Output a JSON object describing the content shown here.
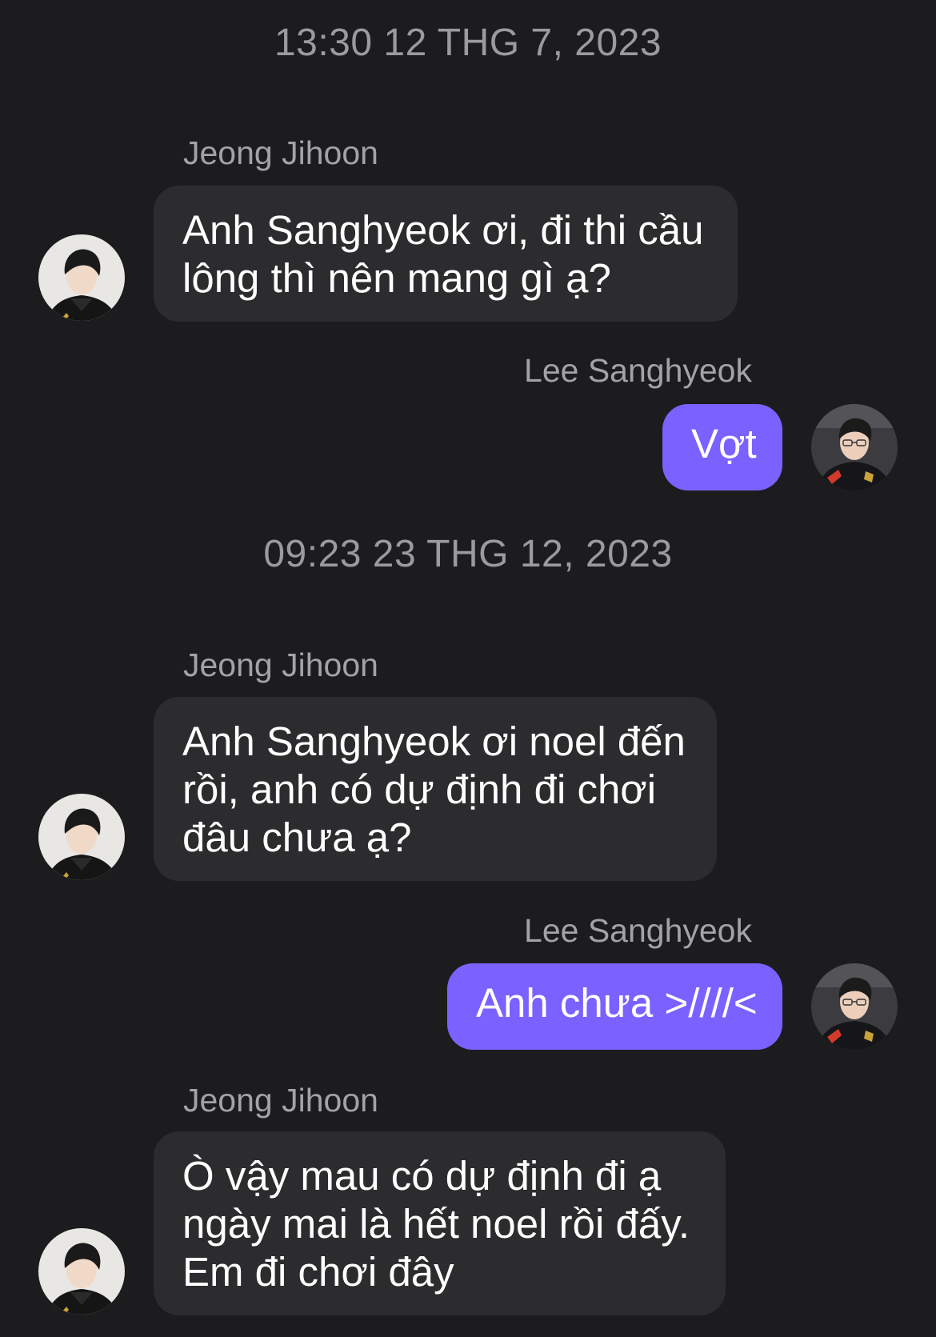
{
  "conversation": {
    "timestamps": [
      "13:30 12 THG 7, 2023",
      "09:23 23 THG 12, 2023"
    ],
    "participants": {
      "incoming": "Jeong Jihoon",
      "outgoing": "Lee Sanghyeok"
    },
    "messages": [
      {
        "sender": "Jeong Jihoon",
        "text": "Anh Sanghyeok ơi, đi thi cầu lông thì nên mang gì ạ?"
      },
      {
        "sender": "Lee Sanghyeok",
        "text": "Vợt"
      },
      {
        "sender": "Jeong Jihoon",
        "text": "Anh Sanghyeok ơi noel đến rồi, anh có dự định đi chơi đâu chưa ạ?"
      },
      {
        "sender": "Lee Sanghyeok",
        "text": "Anh chưa >////<"
      },
      {
        "sender": "Jeong Jihoon",
        "text": "Ò vậy mau có dự định đi ạ ngày mai là hết noel rồi đấy. Em đi chơi đây"
      }
    ]
  },
  "colors": {
    "background": "#1c1c1e",
    "incoming_bubble": "#2c2c2e",
    "outgoing_bubble": "#7b61ff",
    "meta_text": "#9a9a9f"
  },
  "icons": {
    "incoming_avatar": "avatar-photo",
    "outgoing_avatar": "avatar-photo"
  }
}
